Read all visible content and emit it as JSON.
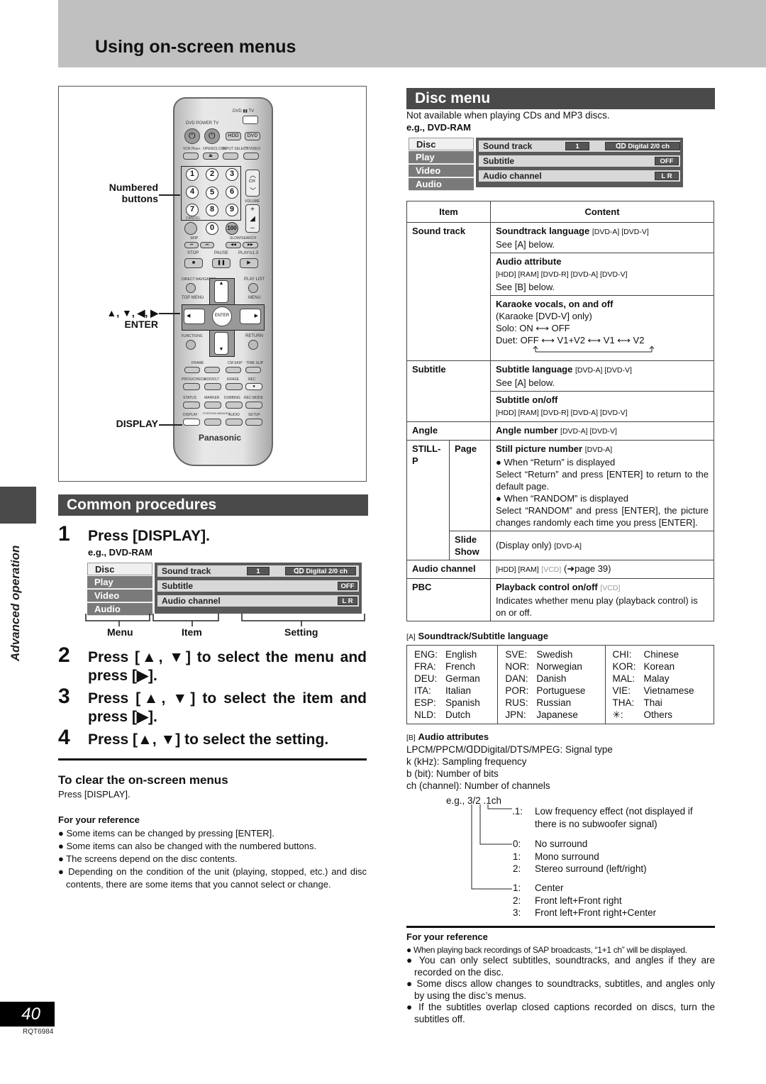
{
  "page": {
    "title": "Using on-screen menus",
    "side_label": "Advanced operation",
    "page_number": "40",
    "doc_code": "RQT6984"
  },
  "remote": {
    "callouts": {
      "numbered": [
        "Numbered",
        "buttons"
      ],
      "arrows": "▲, ▼, ◀, ▶",
      "enter": "ENTER",
      "display": "DISPLAY"
    },
    "labels": {
      "dvd_tv": "DVD ▮▮ TV",
      "power": "DVD POWER TV",
      "hdd": "HDD",
      "dvd": "DVD",
      "vcr_plus": "VCR Plus+",
      "open_close": "OPEN/CLOSE",
      "input_select": "INPUT SELECT",
      "tv_video": "TV/VIDEO",
      "ch": "CH",
      "volume": "VOLUME",
      "cancel": "CANCEL",
      "hundred": "100",
      "skip": "SKIP",
      "slow_search": "SLOW/SEARCH",
      "stop": "STOP",
      "pause": "PAUSE",
      "play": "PLAY/x1.3",
      "direct_navigator": "DIRECT NAVIGATOR",
      "play_list": "PLAY LIST",
      "top_menu": "TOP MENU",
      "menu": "MENU",
      "enter_btn": "ENTER",
      "functions": "FUNCTIONS",
      "return": "RETURN",
      "frame": "FRAME",
      "cm_skip": "CM SKIP",
      "time_slip": "TIME SLIP",
      "prog_check": "PROG/CHECK",
      "add_dlt": "ADD/DLT",
      "erase": "ERASE",
      "rec": "REC",
      "status": "STATUS",
      "marker": "MARKER",
      "dubbing": "DUBBING",
      "rec_mode": "REC MODE",
      "display_btn": "DISPLAY",
      "position_memory": "POSITION MEMORY",
      "audio": "AUDIO",
      "setup": "SETUP",
      "brand": "Panasonic"
    },
    "digits": [
      "1",
      "2",
      "3",
      "4",
      "5",
      "6",
      "7",
      "8",
      "9",
      "0"
    ]
  },
  "common": {
    "heading": "Common procedures",
    "steps": [
      {
        "num": "1",
        "text": "Press [DISPLAY]."
      },
      {
        "num": "2",
        "text": "Press [▲, ▼] to select the menu and press [▶]."
      },
      {
        "num": "3",
        "text": "Press [▲, ▼] to select the item and press [▶]."
      },
      {
        "num": "4",
        "text": "Press [▲, ▼] to select the setting."
      }
    ],
    "example_label": "e.g., DVD-RAM",
    "osd_captions": {
      "menu": "Menu",
      "item": "Item",
      "setting": "Setting"
    },
    "clear_heading": "To clear the on-screen menus",
    "clear_text": "Press [DISPLAY].",
    "ref_heading": "For your reference",
    "ref_bullets": [
      "Some items can be changed by pressing [ENTER].",
      "Some items can also be changed with the numbered buttons.",
      "The screens depend on the disc contents.",
      "Depending on the condition of the unit (playing, stopped, etc.) and disc contents, there are some items that you cannot select or change."
    ]
  },
  "osd": {
    "tabs": [
      "Disc",
      "Play",
      "Video",
      "Audio"
    ],
    "active_tab": "Disc",
    "rows": [
      {
        "label": "Sound track",
        "value1": "1",
        "value2": "ᗡᗞ Digital   2/0 ch"
      },
      {
        "label": "Subtitle",
        "value": "OFF"
      },
      {
        "label": "Audio channel",
        "value": "L R"
      }
    ]
  },
  "disc_menu": {
    "heading": "Disc menu",
    "note": "Not available when playing CDs and MP3 discs.",
    "example_label": "e.g., DVD-RAM",
    "table": {
      "headers": [
        "Item",
        "Content"
      ],
      "sound_track": {
        "item": "Sound track",
        "c1_title": "Soundtrack language",
        "c1_tags": "[DVD-A] [DVD-V]",
        "c1_text": "See [A] below.",
        "c2_title": "Audio attribute",
        "c2_tags": "[HDD] [RAM] [DVD-R] [DVD-A] [DVD-V]",
        "c2_text": "See [B] below.",
        "c3_title": "Karaoke vocals, on and off",
        "c3_line1": "(Karaoke [DVD-V] only)",
        "c3_solo": "Solo: ON ⟷ OFF",
        "c3_duet": "Duet: OFF ⟷ V1+V2 ⟷ V1 ⟷ V2"
      },
      "subtitle": {
        "item": "Subtitle",
        "c1_title": "Subtitle language",
        "c1_tags": "[DVD-A] [DVD-V]",
        "c1_text": "See [A] below.",
        "c2_title": "Subtitle on/off",
        "c2_tags": "[HDD] [RAM] [DVD-R] [DVD-A] [DVD-V]"
      },
      "angle": {
        "item": "Angle",
        "title": "Angle number",
        "tags": "[DVD-A] [DVD-V]"
      },
      "still_p": {
        "item": "STILL-P",
        "page_label": "Page",
        "page_title": "Still picture number",
        "page_tags": "[DVD-A]",
        "page_b1": "When “Return” is displayed",
        "page_t1": "Select “Return” and press [ENTER] to return to the default page.",
        "page_b2": "When “RANDOM” is displayed",
        "page_t2": "Select “RANDOM” and press [ENTER], the picture changes randomly each time you press [ENTER].",
        "slide_label": "Slide Show",
        "slide_text": "(Display only)",
        "slide_tags": "[DVD-A]"
      },
      "audio_channel": {
        "item": "Audio channel",
        "tags": "[HDD] [RAM]",
        "tag_grey": "[VCD]",
        "ref": "(➜page 39)"
      },
      "pbc": {
        "item": "PBC",
        "title": "Playback control on/off",
        "tag_grey": "[VCD]",
        "text": "Indicates whether menu play (playback control) is on or off."
      }
    },
    "lang_heading_prefix": "[A]",
    "lang_heading": "Soundtrack/Subtitle language",
    "languages": [
      [
        [
          "ENG:",
          "English"
        ],
        [
          "FRA:",
          "French"
        ],
        [
          "DEU:",
          "German"
        ],
        [
          "ITA:",
          "Italian"
        ],
        [
          "ESP:",
          "Spanish"
        ],
        [
          "NLD:",
          "Dutch"
        ]
      ],
      [
        [
          "SVE:",
          "Swedish"
        ],
        [
          "NOR:",
          "Norwegian"
        ],
        [
          "DAN:",
          "Danish"
        ],
        [
          "POR:",
          "Portuguese"
        ],
        [
          "RUS:",
          "Russian"
        ],
        [
          "JPN:",
          "Japanese"
        ]
      ],
      [
        [
          "CHI:",
          "Chinese"
        ],
        [
          "KOR:",
          "Korean"
        ],
        [
          "MAL:",
          "Malay"
        ],
        [
          "VIE:",
          "Vietnamese"
        ],
        [
          "THA:",
          "Thai"
        ],
        [
          "✳:",
          "Others"
        ]
      ]
    ],
    "attr_heading_prefix": "[B]",
    "attr_heading": "Audio attributes",
    "attr_lines": [
      "LPCM/PPCM/ᗡᗞDigital/DTS/MPEG: Signal type",
      "k (kHz): Sampling frequency",
      "b (bit): Number of bits",
      "ch (channel): Number of channels"
    ],
    "example": "e.g., 3/2 .1ch",
    "lfe": {
      "code": ".1:",
      "text": "Low frequency effect (not displayed if there is no subwoofer signal)"
    },
    "surround": [
      [
        "0:",
        "No surround"
      ],
      [
        "1:",
        "Mono surround"
      ],
      [
        "2:",
        "Stereo surround (left/right)"
      ]
    ],
    "front": [
      [
        "1:",
        "Center"
      ],
      [
        "2:",
        "Front left+Front right"
      ],
      [
        "3:",
        "Front left+Front right+Center"
      ]
    ],
    "ref_heading": "For your reference",
    "ref_bullets": [
      "When playing back recordings of SAP broadcasts, “1+1 ch” will be displayed.",
      "You can only select subtitles, soundtracks, and angles if they are recorded on the disc.",
      "Some discs allow changes to soundtracks, subtitles, and angles only by using the disc’s menus.",
      "If the subtitles overlap closed captions recorded on discs, turn the subtitles off."
    ]
  }
}
